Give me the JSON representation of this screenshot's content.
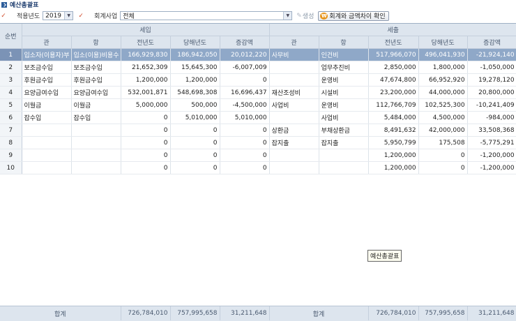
{
  "title": "예산총괄표",
  "filters": {
    "year_label": "적용년도",
    "year_value": "2019",
    "business_label": "회계사업",
    "business_value": "전체",
    "generate_label": "생성",
    "diff_button_label": "회계와 금액차이 확인"
  },
  "grid": {
    "seq_header": "순번",
    "income_header": "세입",
    "expense_header": "세출",
    "sub_headers": [
      "관",
      "항",
      "전년도",
      "당해년도",
      "증감액",
      "관",
      "항",
      "전년도",
      "당해년도",
      "증감액"
    ],
    "rows": [
      [
        "1",
        "입소자(이용자)부",
        "입소(이용)비용수",
        "166,929,830",
        "186,942,050",
        "20,012,220",
        "사무비",
        "인건비",
        "517,966,070",
        "496,041,930",
        "-21,924,140"
      ],
      [
        "2",
        "보조금수입",
        "보조금수입",
        "21,652,309",
        "15,645,300",
        "-6,007,009",
        "",
        "업무추진비",
        "2,850,000",
        "1,800,000",
        "-1,050,000"
      ],
      [
        "3",
        "후원금수입",
        "후원금수입",
        "1,200,000",
        "1,200,000",
        "0",
        "",
        "운영비",
        "47,674,800",
        "66,952,920",
        "19,278,120"
      ],
      [
        "4",
        "요양급여수입",
        "요양급여수입",
        "532,001,871",
        "548,698,308",
        "16,696,437",
        "재산조성비",
        "시설비",
        "23,200,000",
        "44,000,000",
        "20,800,000"
      ],
      [
        "5",
        "이월금",
        "이월금",
        "5,000,000",
        "500,000",
        "-4,500,000",
        "사업비",
        "운영비",
        "112,766,709",
        "102,525,300",
        "-10,241,409"
      ],
      [
        "6",
        "잡수입",
        "잡수입",
        "0",
        "5,010,000",
        "5,010,000",
        "",
        "사업비",
        "5,484,000",
        "4,500,000",
        "-984,000"
      ],
      [
        "7",
        "",
        "",
        "0",
        "0",
        "0",
        "상환금",
        "부채상환금",
        "8,491,632",
        "42,000,000",
        "33,508,368"
      ],
      [
        "8",
        "",
        "",
        "0",
        "0",
        "0",
        "잡지출",
        "잡지출",
        "5,950,799",
        "175,508",
        "-5,775,291"
      ],
      [
        "9",
        "",
        "",
        "0",
        "0",
        "0",
        "",
        "",
        "1,200,000",
        "0",
        "-1,200,000"
      ],
      [
        "10",
        "",
        "",
        "0",
        "0",
        "0",
        "",
        "",
        "1,200,000",
        "0",
        "-1,200,000"
      ]
    ]
  },
  "tooltip": "예산총괄표",
  "footer": {
    "income_label": "합계",
    "income_prev": "726,784,010",
    "income_curr": "757,995,658",
    "income_diff": "31,211,648",
    "expense_label": "합계",
    "expense_prev": "726,784,010",
    "expense_curr": "757,995,658",
    "expense_diff": "31,211,648"
  }
}
